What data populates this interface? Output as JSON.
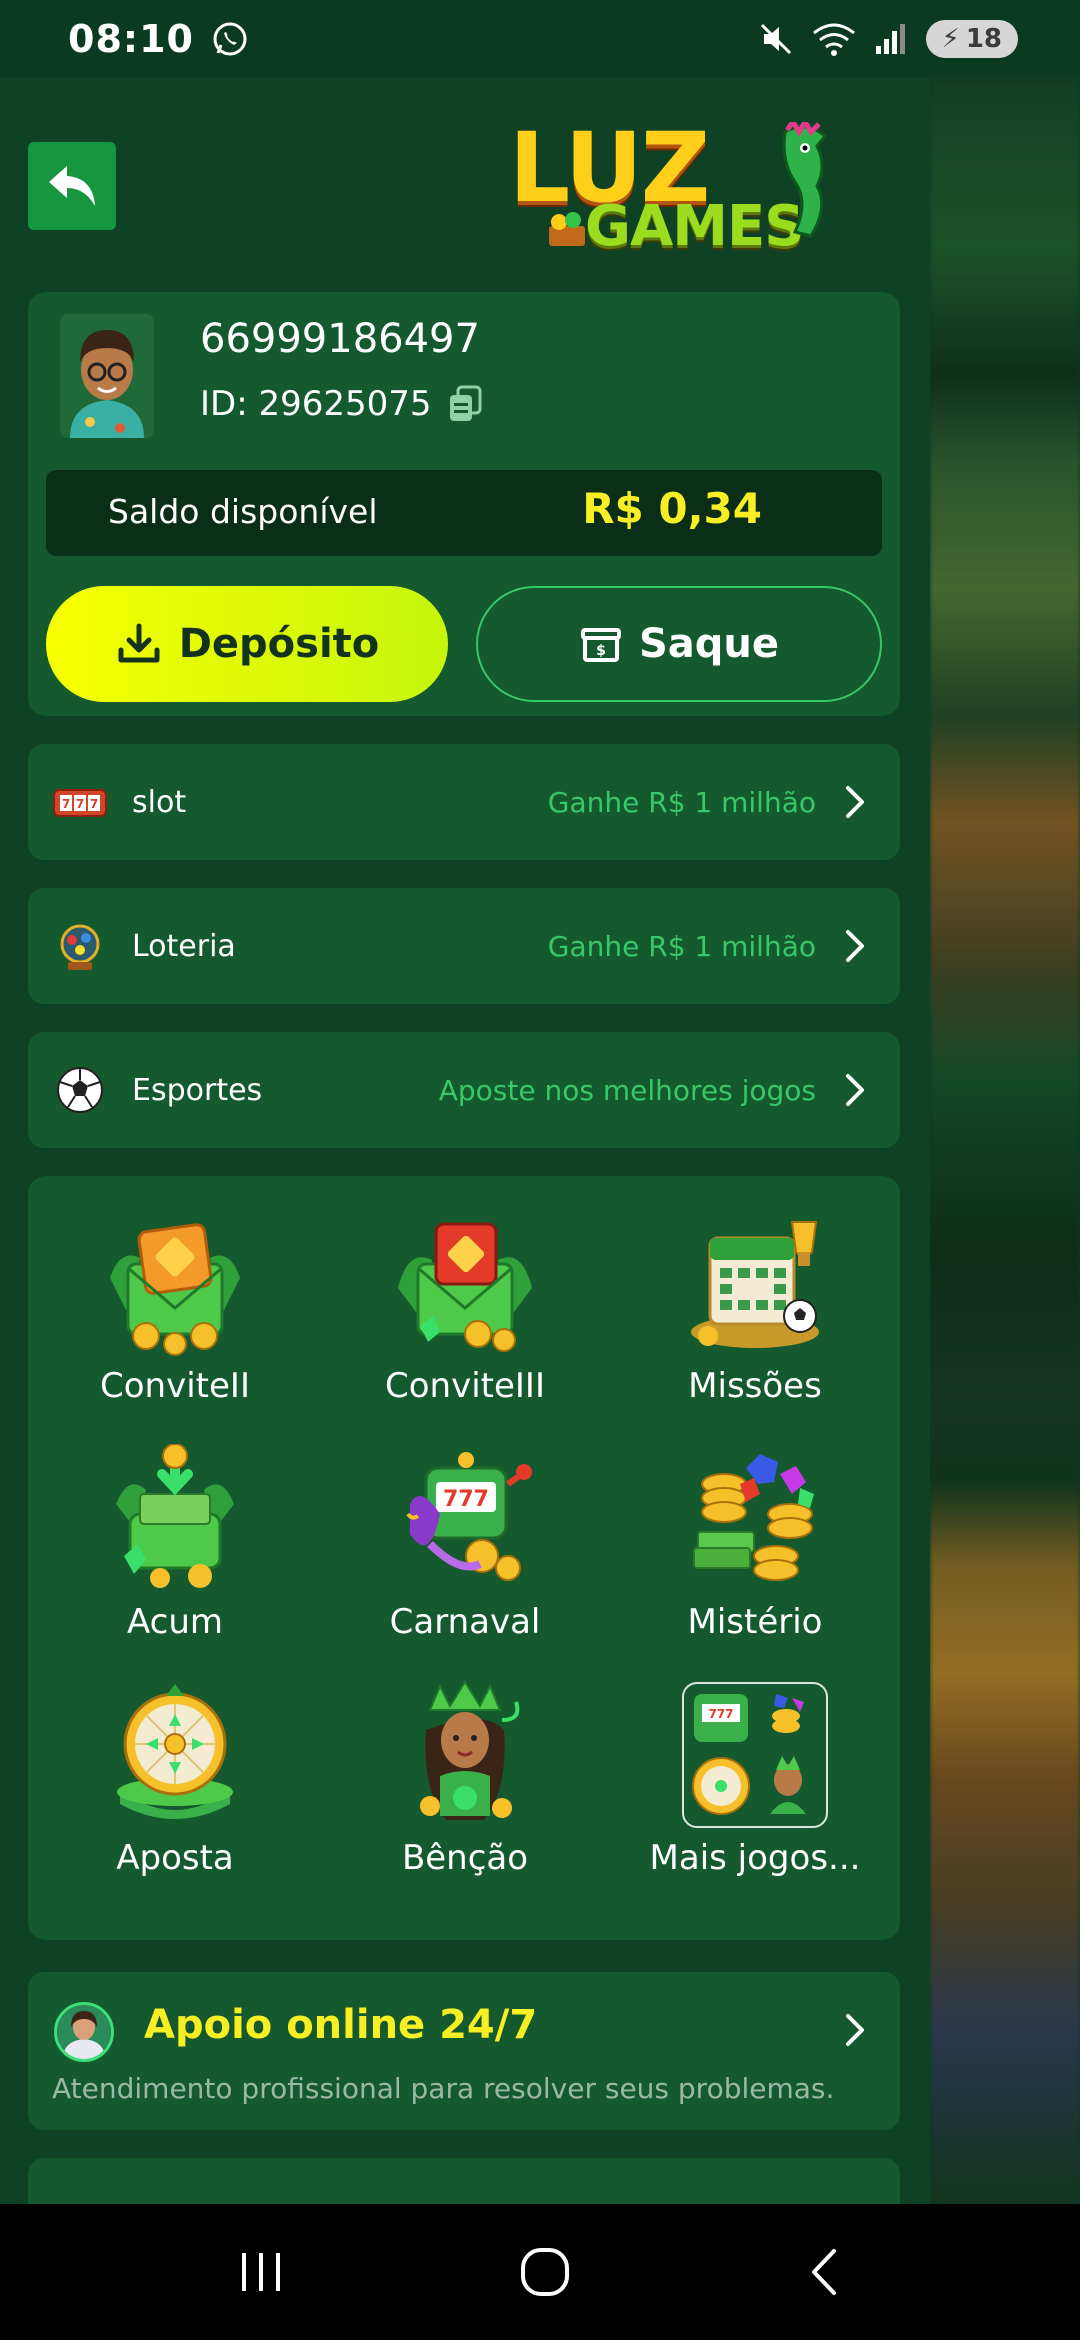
{
  "status_bar": {
    "time": "08:10",
    "battery": "18"
  },
  "header": {
    "logo_line1": "LUZ",
    "logo_line2": "GAMES"
  },
  "user": {
    "phone": "66999186497",
    "id": "ID: 29625075",
    "balance_label": "Saldo disponível",
    "balance_value": "R$ 0,34",
    "deposit_label": "Depósito",
    "withdraw_label": "Saque"
  },
  "categories": [
    {
      "label": "slot",
      "promo": "Ganhe R$ 1 milhão",
      "icon": "slot-machine-icon"
    },
    {
      "label": "Loteria",
      "promo": "Ganhe R$ 1 milhão",
      "icon": "lottery-icon"
    },
    {
      "label": "Esportes",
      "promo": "Aposte nos melhores jogos",
      "icon": "soccer-ball-icon"
    }
  ],
  "features": [
    {
      "label": "ConviteII",
      "icon": "invite-envelope-icon"
    },
    {
      "label": "ConviteIII",
      "icon": "invite-envelope-red-icon"
    },
    {
      "label": "Missões",
      "icon": "missions-calendar-icon"
    },
    {
      "label": "Acum",
      "icon": "accumulate-wallet-icon"
    },
    {
      "label": "Carnaval",
      "icon": "carnival-slot-icon"
    },
    {
      "label": "Mistério",
      "icon": "mystery-coins-icon"
    },
    {
      "label": "Aposta",
      "icon": "bet-wheel-icon"
    },
    {
      "label": "Bênção",
      "icon": "blessing-goddess-icon"
    },
    {
      "label": "Mais jogos...",
      "icon": "more-games-icon"
    }
  ],
  "support": {
    "title": "Apoio online 24/7",
    "subtitle": "Atendimento profissional para resolver seus problemas."
  },
  "colors": {
    "drawer_bg": "#0f4224",
    "card_bg": "#145a2e",
    "accent_yellow": "#f7ef23",
    "accent_green": "#36c869"
  }
}
